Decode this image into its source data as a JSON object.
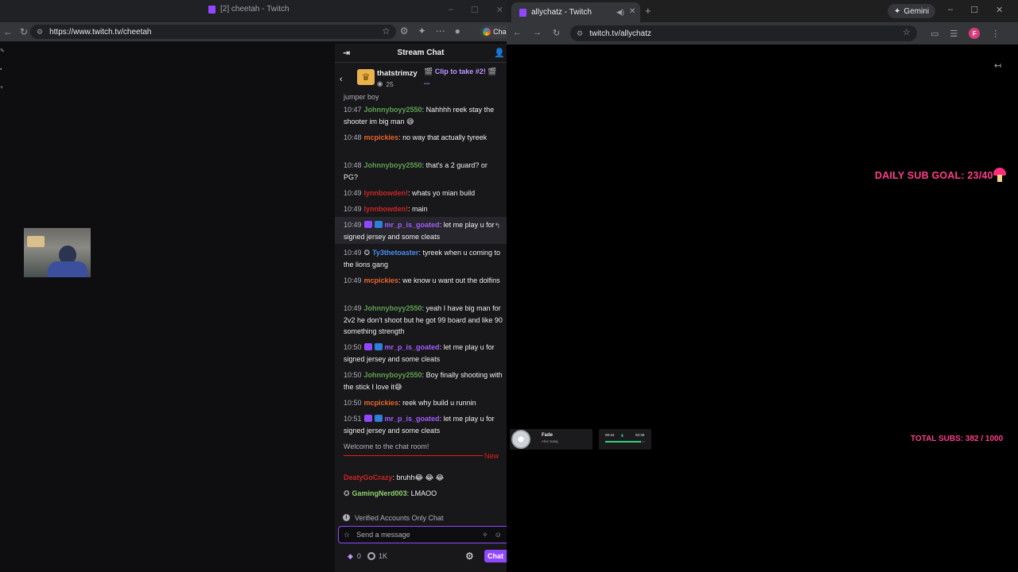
{
  "left_window": {
    "tab_title": "[2] cheetah - Twitch",
    "url": "https://www.twitch.tv/cheetah",
    "profile_chip_label": "Cha",
    "icons": [
      "back-icon",
      "reload-icon",
      "site-info-icon",
      "star-icon",
      "extension-icon",
      "profile-icon"
    ]
  },
  "chat": {
    "header": "Stream Chat",
    "pinned": {
      "user": "thatstrimzy",
      "count": "25",
      "message": "🎬 Clip to take #2! 🎬 ..."
    },
    "partial_top": "jumper boy",
    "messages": [
      {
        "time": "10:47",
        "user": "Johnnyboyy2550",
        "text": ": Nahhhh reek stay the shooter im big man 😅"
      },
      {
        "time": "10:48",
        "user": "mcpickies",
        "text": ": no way that actually tyreek"
      },
      {
        "time": "10:48",
        "user": "Johnnyboyy2550",
        "text": ": that's a 2 guard? or PG?"
      },
      {
        "time": "10:49",
        "user": "lynnbowden!",
        "text": ": whats yo mian build"
      },
      {
        "time": "10:49",
        "user": "lynnbowden!",
        "text": ": main"
      },
      {
        "time": "10:49",
        "user": "mr_p_is_goated",
        "text": ": let me play u for signed jersey and some cleats"
      },
      {
        "time": "10:49",
        "user": "Ty3thetoaster",
        "text": ": tyreek when u coming to the lions gang"
      },
      {
        "time": "10:49",
        "user": "mcpickies",
        "text": ": we know u want out the dolfins"
      },
      {
        "time": "10:49",
        "user": "Johnnyboyy2550",
        "text": ": yeah I have big man for 2v2 he don't shoot but he got 99 board and like 90 something strength"
      },
      {
        "time": "10:50",
        "user": "mr_p_is_goated",
        "text": ": let me play u for signed jersey and some cleats"
      },
      {
        "time": "10:50",
        "user": "Johnnyboyy2550",
        "text": ": Boy finally shooting with the stick I love it😅"
      },
      {
        "time": "10:50",
        "user": "mcpickies",
        "text": ": reek why build u runnin"
      },
      {
        "time": "10:51",
        "user": "mr_p_is_goated",
        "text": ": let me play u for signed jersey and some cleats"
      }
    ],
    "welcome": "Welcome to the chat room!",
    "new_label": "New",
    "after_new": [
      {
        "user": "DeatyGoCrazy",
        "text": ": bruhh😂 😂 😂"
      },
      {
        "user": "GamingNerd003",
        "text": ": LMAOO"
      }
    ],
    "verified_notice": "Verified Accounts Only Chat",
    "input_placeholder": "Send a message",
    "points": "0",
    "ring_count": "1K",
    "chat_button": "Chat",
    "colors": {
      "Johnnyboyy2550": "#5fa050",
      "mcpickies": "#e8642c",
      "lynnbowden!": "#cc2525",
      "mr_p_is_goated": "#a35cff",
      "Ty3thetoaster": "#4c8ef0",
      "DeatyGoCrazy": "#cc2525",
      "GamingNerd003": "#8ed06a",
      "accent": "#9147ff"
    }
  },
  "right_window": {
    "tab_title": "allychatz - Twitch",
    "url": "twitch.tv/allychatz",
    "gemini_label": "Gemini",
    "profile_initial": "F",
    "overlay": {
      "sub_goal": "DAILY SUB GOAL: 23/40",
      "total_subs": "TOTAL SUBS: 382 / 1000",
      "goal_color": "#ff3d8b"
    },
    "now_playing": {
      "title": "Fade",
      "artist": "Alex Isaiaj",
      "elapsed": "00:44",
      "total": "02:36",
      "progress": 0.9
    }
  }
}
